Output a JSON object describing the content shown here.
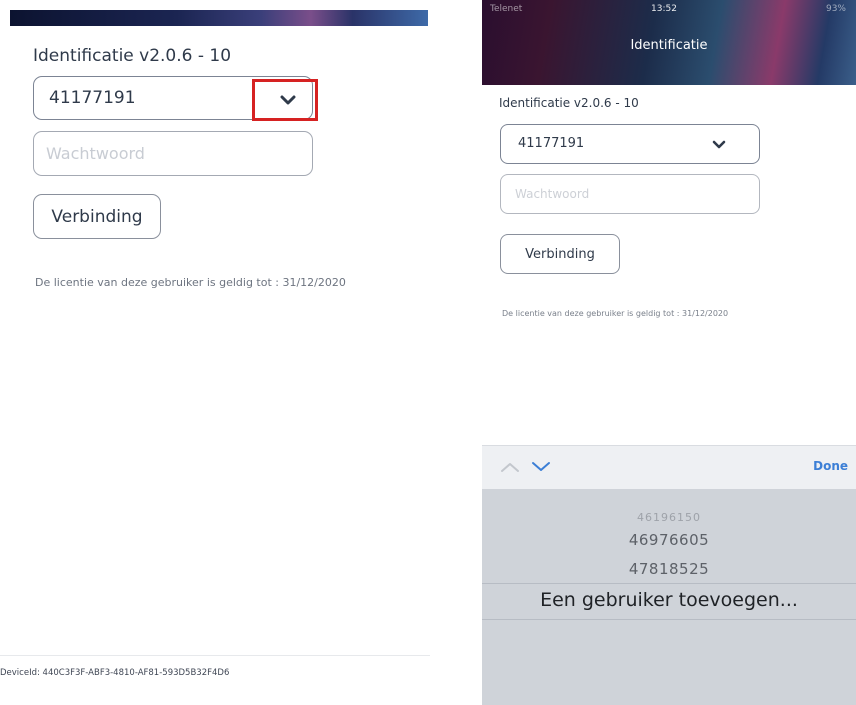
{
  "left": {
    "title": "Identificatie v2.0.6 - 10",
    "selected_user": "41177191",
    "password_placeholder": "Wachtwoord",
    "connect_label": "Verbinding",
    "license_text": "De licentie van deze gebruiker is geldig tot : 31/12/2020",
    "device_id": "DeviceId: 440C3F3F-ABF3-4810-AF81-593D5B32F4D6",
    "dropdown_icon": "chevron-down-icon",
    "highlight_color": "#d62222"
  },
  "right": {
    "status": {
      "carrier": "Telenet",
      "time": "13:52",
      "battery": "93%"
    },
    "header_title": "Identificatie",
    "title": "Identificatie v2.0.6 - 10",
    "selected_user": "41177191",
    "password_placeholder": "Wachtwoord",
    "connect_label": "Verbinding",
    "license_text": "De licentie van deze gebruiker is geldig tot : 31/12/2020",
    "toolbar": {
      "prev_icon": "chevron-up-icon",
      "next_icon": "chevron-down-icon",
      "done_label": "Done"
    },
    "picker_options": [
      "46196150",
      "46976605",
      "47818525",
      "Een gebruiker toevoegen..."
    ],
    "picker_selected": "Een gebruiker toevoegen..."
  }
}
